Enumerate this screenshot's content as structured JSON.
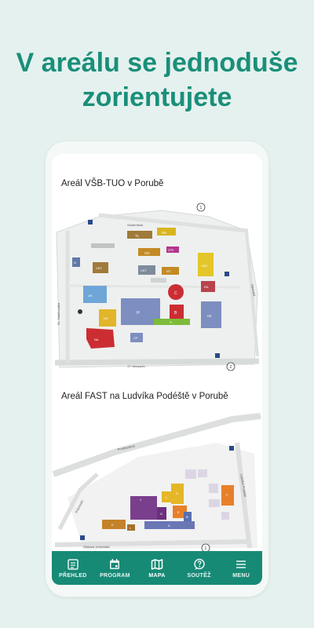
{
  "headline": {
    "line1": "V areálu se jednoduše",
    "line2": "zorientujete"
  },
  "maps": [
    {
      "title": "Areál VŠB-TUO v Porubě",
      "streets": [
        "Studentská",
        "Dr. Slabihoudka",
        "Opavská",
        "17. listopadu"
      ],
      "buildings": [
        "TL",
        "SH",
        "CPIT",
        "CN",
        "CPS",
        "CKT",
        "NT",
        "VEC",
        "H",
        "C",
        "B",
        "RA",
        "RB",
        "NK",
        "NA",
        "A",
        "CP",
        "VSH",
        "UK",
        "N"
      ],
      "markers": [
        "1",
        "2"
      ]
    },
    {
      "title": "Areál FAST na Ludvíka Podéště v Porubě",
      "streets": [
        "Prodloužená",
        "Ludvíka Podéště",
        "Průchodní",
        "Otakara Jeremiáše"
      ],
      "buildings": [
        "A",
        "B",
        "C",
        "D",
        "E",
        "F",
        "G",
        "J",
        "K",
        "L"
      ],
      "markers": [
        "1"
      ]
    }
  ],
  "nav": [
    {
      "label": "PŘEHLED",
      "icon": "overview-icon",
      "active": false
    },
    {
      "label": "PROGRAM",
      "icon": "calendar-icon",
      "active": false
    },
    {
      "label": "MAPA",
      "icon": "map-icon",
      "active": true
    },
    {
      "label": "SOUTĚŽ",
      "icon": "quiz-icon",
      "active": false
    },
    {
      "label": "MENU",
      "icon": "menu-icon",
      "active": false
    }
  ],
  "colors": {
    "brand": "#178a76",
    "headline": "#1a8f7a",
    "background": "#e5f1ee"
  }
}
